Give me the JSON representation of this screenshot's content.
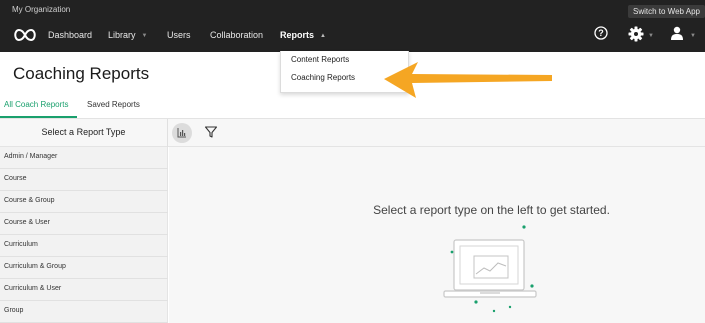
{
  "header": {
    "org_name": "My Organization",
    "switch_label": "Switch to Web App",
    "nav": {
      "dashboard": "Dashboard",
      "library": "Library",
      "users": "Users",
      "collaboration": "Collaboration",
      "reports": "Reports"
    },
    "icons": [
      "logo-icon",
      "help-icon",
      "gear-icon",
      "user-icon",
      "chevron-down-icon"
    ]
  },
  "reports_menu": {
    "items": [
      "Content Reports",
      "Coaching Reports"
    ]
  },
  "page": {
    "title": "Coaching Reports",
    "tabs": [
      "All Coach Reports",
      "Saved Reports"
    ]
  },
  "toolbar": {
    "select_label": "Select a Report Type",
    "icons": [
      "bar-chart-icon",
      "filter-icon"
    ]
  },
  "sidebar": {
    "items": [
      "Admin / Manager",
      "Course",
      "Course & Group",
      "Course & User",
      "Curriculum",
      "Curriculum & Group",
      "Curriculum & User",
      "Group"
    ]
  },
  "main": {
    "empty_message": "Select a report type on the left to get started."
  },
  "colors": {
    "header_bg": "#222222",
    "accent": "#1aa06d",
    "annotation_arrow": "#f5a623"
  }
}
